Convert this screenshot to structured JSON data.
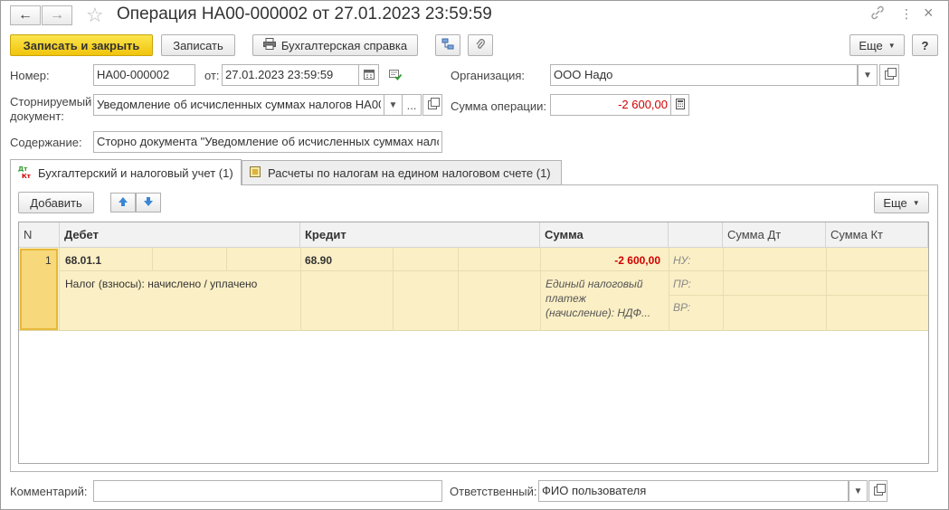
{
  "window": {
    "title": "Операция НА00-000002 от 27.01.2023 23:59:59",
    "back_icon": "←",
    "forward_icon": "→",
    "star_icon": "☆",
    "link_icon": "🔗",
    "more_icon": "⋮",
    "close_icon": "×"
  },
  "toolbar": {
    "save_close": "Записать и закрыть",
    "save": "Записать",
    "report": "Бухгалтерская справка",
    "more": "Еще",
    "help": "?"
  },
  "form": {
    "number_label": "Номер:",
    "number_value": "НА00-000002",
    "date_label": "от:",
    "date_value": "27.01.2023 23:59:59",
    "org_label": "Организация:",
    "org_value": "ООО Надо",
    "storno_label_1": "Сторнируемый",
    "storno_label_2": "документ:",
    "storno_value": "Уведомление об исчисленных суммах налогов НА00",
    "sum_label": "Сумма операции:",
    "sum_value": "-2 600,00",
    "content_label": "Содержание:",
    "content_value": "Сторно документа \"Уведомление об исчисленных суммах нало",
    "ellipsis": "..."
  },
  "tabs": [
    {
      "label": "Бухгалтерский и налоговый учет (1)",
      "icon": "Дт/Кт"
    },
    {
      "label": "Расчеты по налогам на едином налоговом счете (1)"
    }
  ],
  "table_toolbar": {
    "add": "Добавить",
    "up_icon": "▲",
    "down_icon": "▼",
    "more": "Еще"
  },
  "table": {
    "headers": {
      "n": "N",
      "debit": "Дебет",
      "credit": "Кредит",
      "sum": "Сумма",
      "sum_dt": "Сумма Дт",
      "sum_kt": "Сумма Кт"
    },
    "rows": [
      {
        "n": "1",
        "debit_account": "68.01.1",
        "debit_sub": "Налог (взносы): начислено / уплачено",
        "credit_account": "68.90",
        "sum": "-2 600,00",
        "sum_desc_1": "Единый налоговый",
        "sum_desc_2": "платеж",
        "sum_desc_3": "(начисление): НДФ...",
        "nu": "НУ:",
        "pr": "ПР:",
        "vr": "ВР:"
      }
    ]
  },
  "footer": {
    "comment_label": "Комментарий:",
    "comment_value": "",
    "responsible_label": "Ответственный:",
    "responsible_value": "ФИО пользователя"
  },
  "colors": {
    "primary_button": "#f5d21d",
    "selected_row": "#fbefc5",
    "negative": "#d00000"
  }
}
